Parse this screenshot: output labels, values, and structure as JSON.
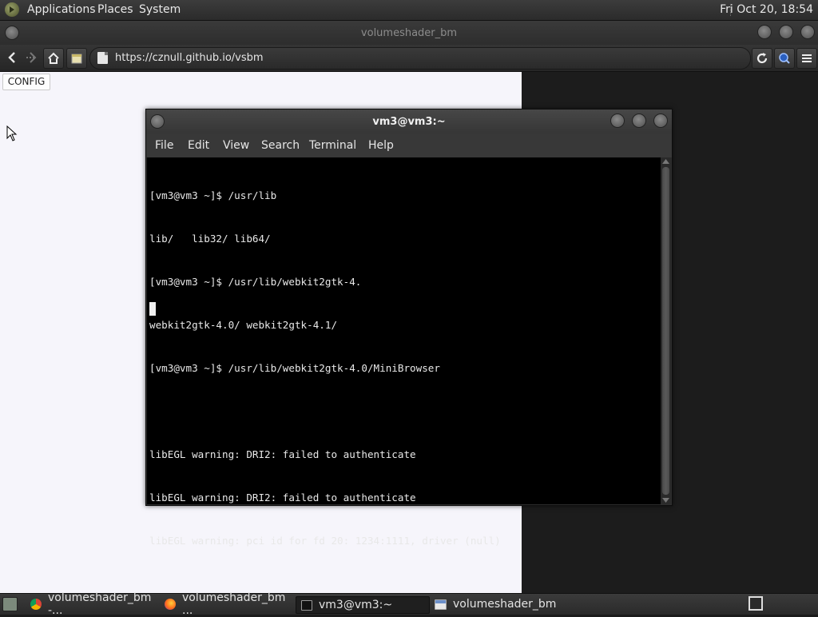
{
  "top_panel": {
    "menus": [
      "Applications",
      "Places",
      "System"
    ],
    "clock": "Fri Oct 20, 18:54"
  },
  "browser": {
    "title": "volumeshader_bm",
    "url": "https://cznull.github.io/vsbm",
    "page": {
      "config_label": "CONFIG"
    }
  },
  "terminal": {
    "title": "vm3@vm3:~",
    "menu": [
      "File",
      "Edit",
      "View",
      "Search",
      "Terminal",
      "Help"
    ],
    "lines": [
      "[vm3@vm3 ~]$ /usr/lib",
      "lib/   lib32/ lib64/",
      "[vm3@vm3 ~]$ /usr/lib/webkit2gtk-4.",
      "webkit2gtk-4.0/ webkit2gtk-4.1/",
      "[vm3@vm3 ~]$ /usr/lib/webkit2gtk-4.0/MiniBrowser",
      "",
      "libEGL warning: DRI2: failed to authenticate",
      "libEGL warning: DRI2: failed to authenticate",
      "libEGL warning: pci id for fd 20: 1234:1111, driver (null)"
    ]
  },
  "taskbar": {
    "tasks": [
      {
        "label": "volumeshader_bm -...",
        "icon": "chrome-icon"
      },
      {
        "label": "volumeshader_bm ...",
        "icon": "firefox-icon"
      },
      {
        "label": "vm3@vm3:~",
        "icon": "terminal-icon"
      },
      {
        "label": "volumeshader_bm",
        "icon": "browser-window-icon"
      }
    ]
  },
  "colors": {
    "panel_bg": "#2b2b2b",
    "terminal_bg": "#000000",
    "page_bg": "#f6f5fb"
  }
}
